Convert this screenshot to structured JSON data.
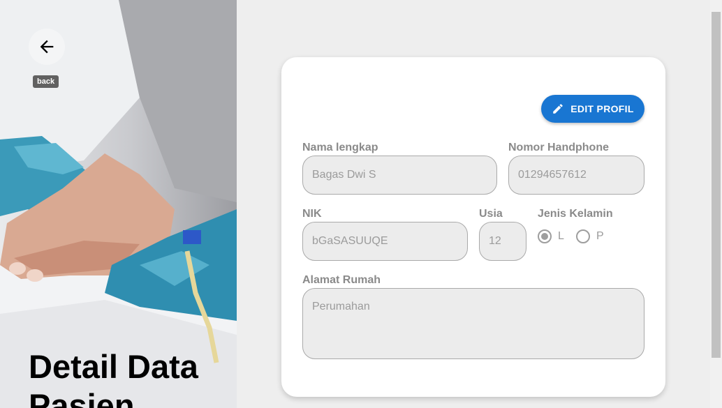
{
  "back": {
    "tooltip": "back",
    "icon": "arrow-left-icon"
  },
  "page": {
    "title": "Detail Data Pasien"
  },
  "card": {
    "edit_button": {
      "label": "EDIT PROFIL",
      "icon": "pencil-icon",
      "color": "#1976d2"
    },
    "fields": {
      "name": {
        "label": "Nama lengkap",
        "value": "Bagas Dwi S"
      },
      "phone": {
        "label": "Nomor Handphone",
        "value": "01294657612"
      },
      "nik": {
        "label": "NIK",
        "value": "bGaSASUUQE"
      },
      "age": {
        "label": "Usia",
        "value": "12"
      },
      "gender": {
        "label": "Jenis Kelamin",
        "options": [
          "L",
          "P"
        ],
        "selected": "L"
      },
      "address": {
        "label": "Alamat Rumah",
        "value": "Perumahan"
      }
    }
  }
}
